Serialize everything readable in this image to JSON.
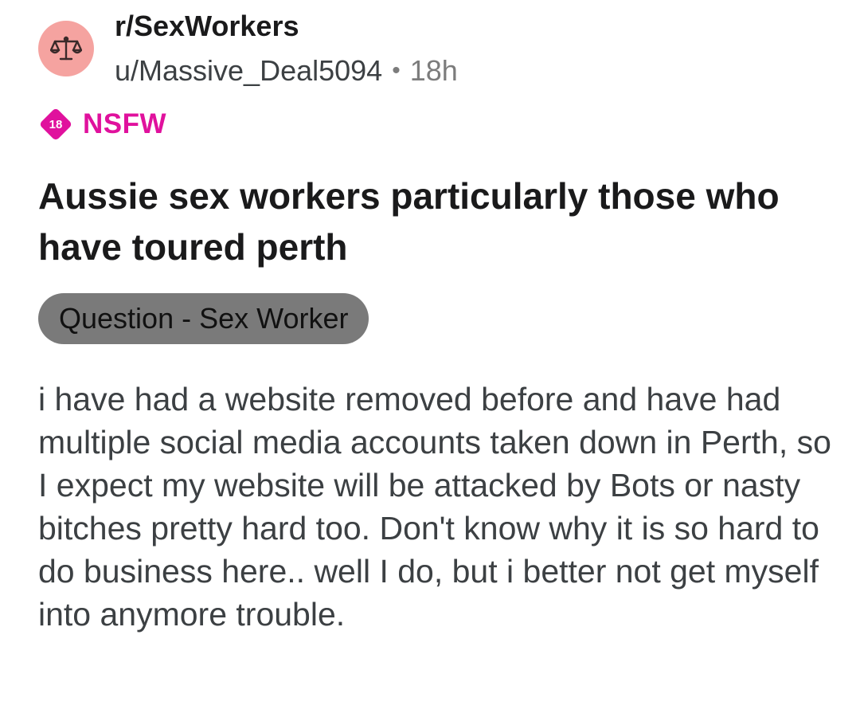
{
  "post": {
    "subreddit": "r/SexWorkers",
    "author": "u/Massive_Deal5094",
    "separator": "•",
    "age": "18h",
    "avatar_icon": "scales-icon",
    "avatar_color": "#f5a3a0",
    "nsfw": {
      "badge_number": "18",
      "label": "NSFW",
      "color": "#e0119d"
    },
    "title": "Aussie sex workers particularly those who have toured perth",
    "flair": "Question - Sex Worker",
    "body": "i have had a website removed before and have had multiple social media accounts taken down in Perth, so I expect my website will be attacked by Bots or nasty bitches pretty hard too. Don't know why it is so hard to do business here.. well I do, but i better not get myself into anymore trouble."
  }
}
